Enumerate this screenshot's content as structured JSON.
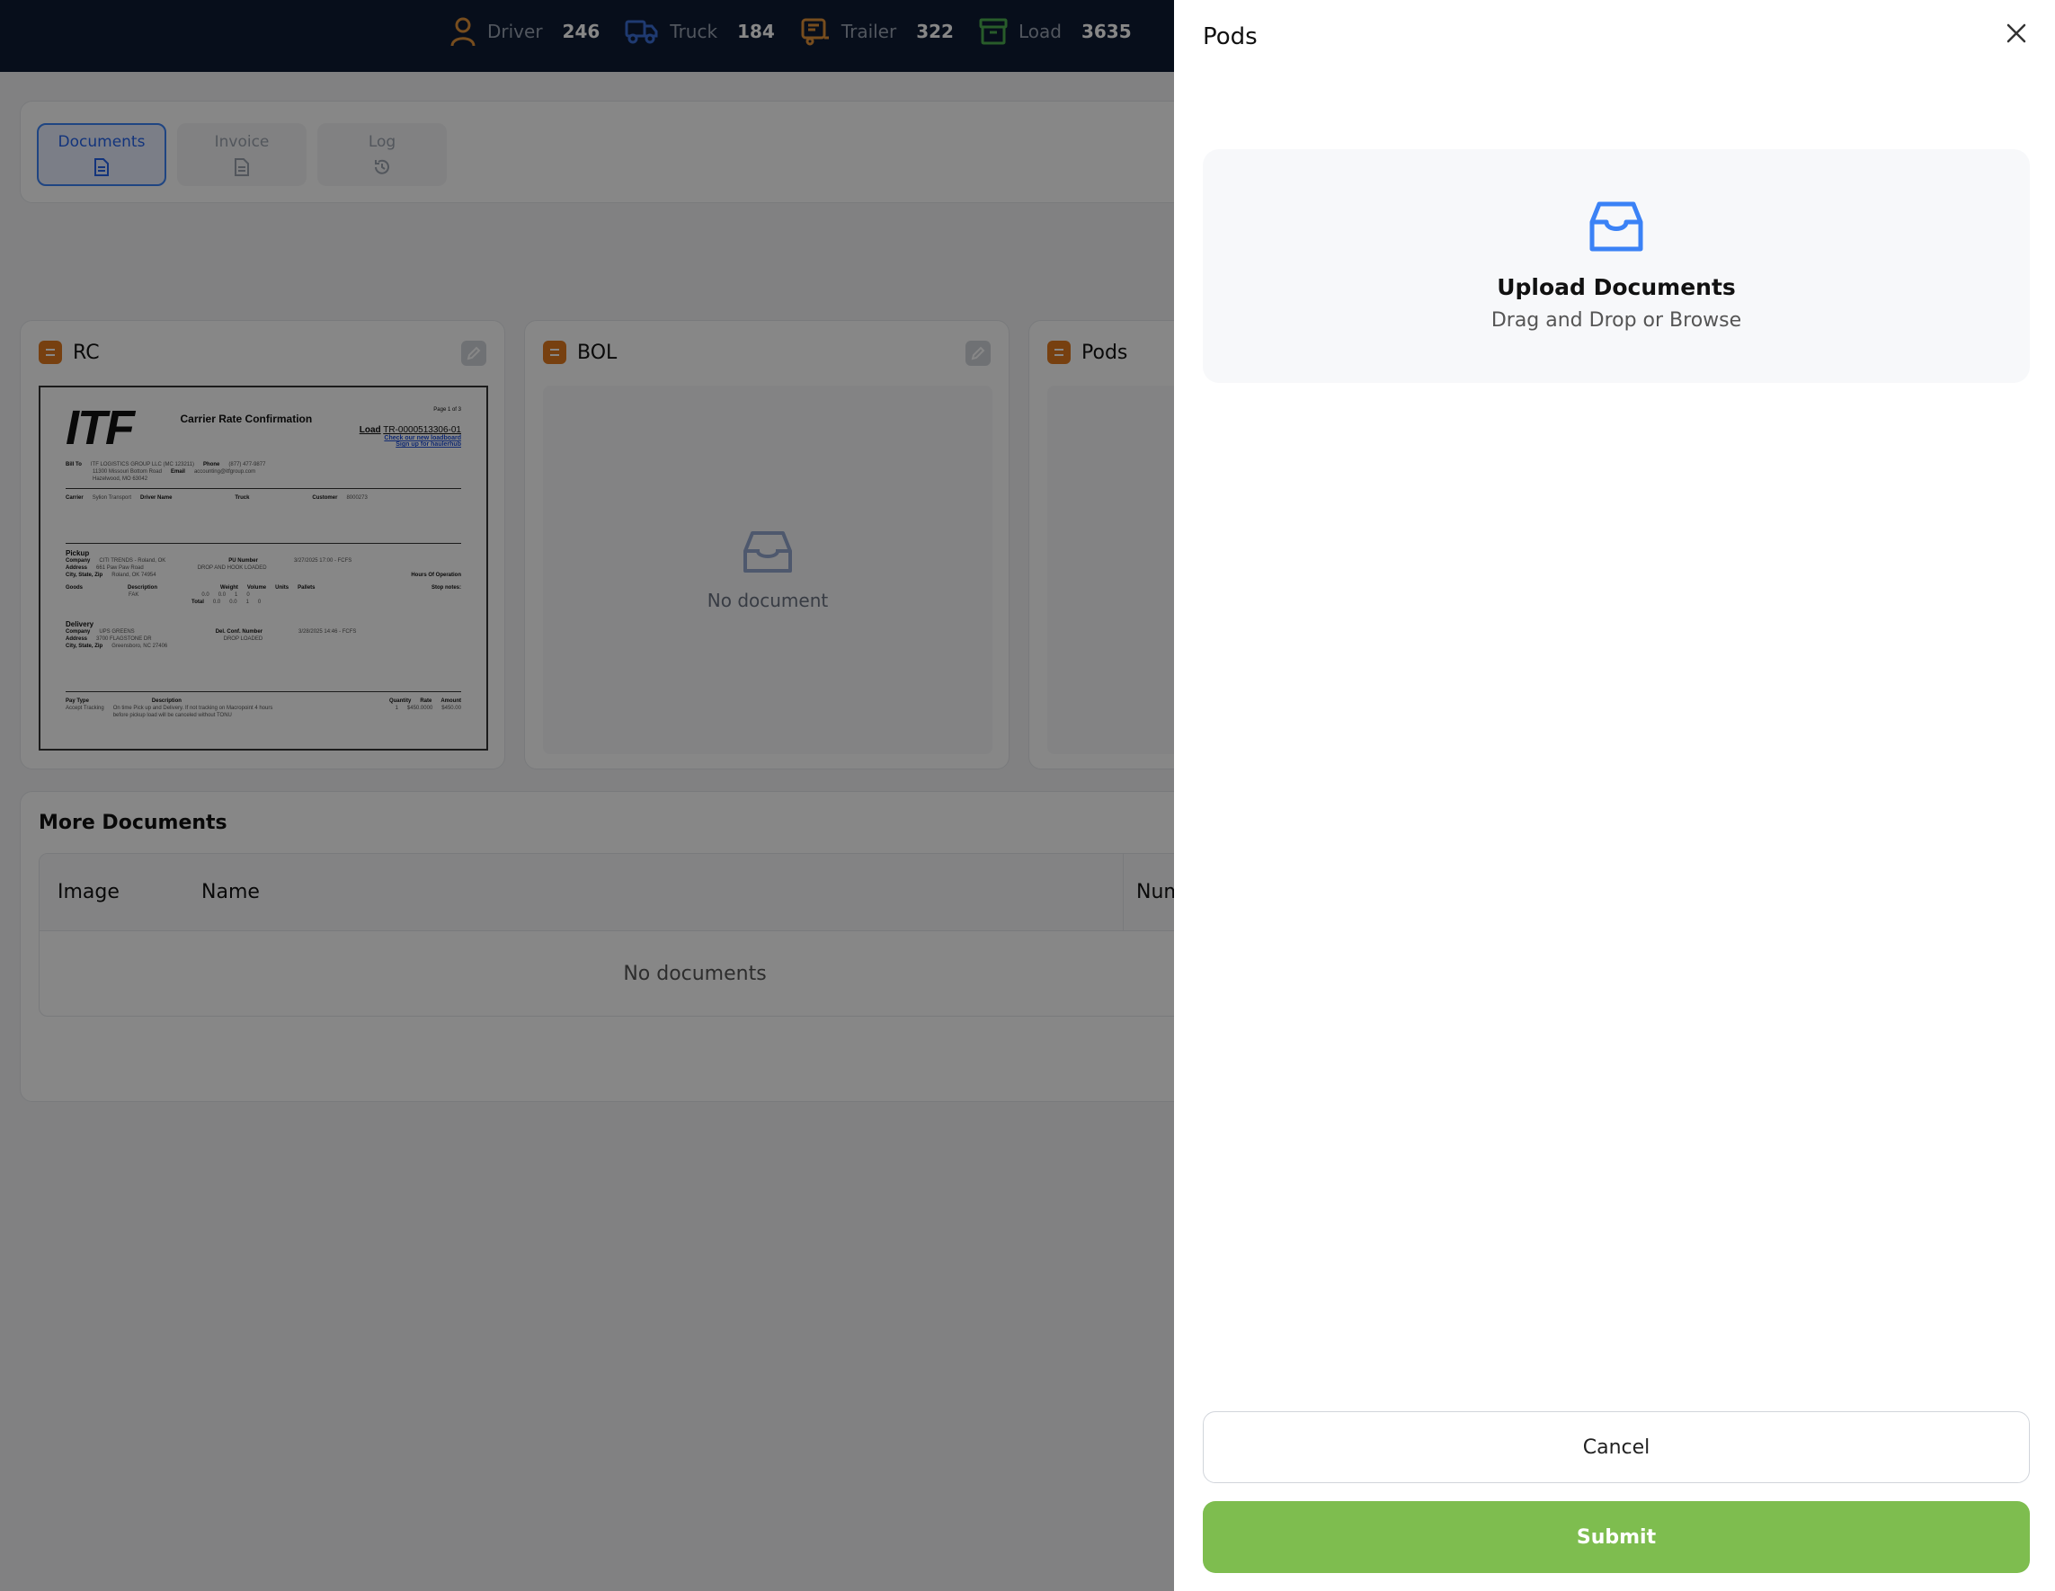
{
  "topbar": {
    "stats": [
      {
        "label": "Driver",
        "count": "246",
        "icon": "person-icon",
        "color": "#e0913a"
      },
      {
        "label": "Truck",
        "count": "184",
        "icon": "truck-icon",
        "color": "#3b6fd6"
      },
      {
        "label": "Trailer",
        "count": "322",
        "icon": "trailer-icon",
        "color": "#e0913a"
      },
      {
        "label": "Load",
        "count": "3635",
        "icon": "box-icon",
        "color": "#4caf50"
      }
    ]
  },
  "tabs": [
    {
      "label": "Documents",
      "active": true
    },
    {
      "label": "Invoice",
      "active": false
    },
    {
      "label": "Log",
      "active": false
    }
  ],
  "doc_cards": [
    {
      "title": "RC"
    },
    {
      "title": "BOL",
      "empty_text": "No document"
    },
    {
      "title": "Pods"
    }
  ],
  "rc_preview": {
    "logo": "ITF",
    "title": "Carrier Rate Confirmation",
    "page": "Page 1 of 3",
    "load_label": "Load",
    "load_number": "TR-0000513306-01",
    "link1": "Check our new loadboard",
    "link2": "Sign up for haulerhub",
    "bill_to_label": "Bill To",
    "bill_to": "ITF LOGISTICS GROUP LLC (MC 123211)",
    "bill_addr1": "11300 Missouri Bottom Road",
    "bill_addr2": "Hazelwood, MO 63042",
    "phone_label": "Phone",
    "phone": "(877) 477-9877",
    "email_label": "Email",
    "email": "accounting@itfgroup.com",
    "carrier_label": "Carrier",
    "carrier": "Sylion Transport",
    "driver_name_label": "Driver Name",
    "truck_label": "Truck",
    "customer_label": "Customer",
    "customer": "8000273",
    "pickup_label": "Pickup",
    "pickup_company_label": "Company",
    "pickup_company": "CITI TRENDS - Roland, OK",
    "pickup_address_label": "Address",
    "pickup_address": "661 Paw Paw Road",
    "pickup_city_label": "City, State, Zip",
    "pickup_city": "Roland, OK 74954",
    "pu_number_label": "PU Number",
    "pickup_note": "DROP AND HOOK LOADED",
    "appointment_label": "Appointment",
    "pickup_appt": "3/27/2025 17:00 - FCFS",
    "hours_label": "Hours Of Operation",
    "stop_notes_label": "Stop notes:",
    "goods_label": "Goods",
    "description_label": "Description",
    "weight_label": "Weight",
    "volume_label": "Volume",
    "units_label": "Units",
    "pallets_label": "Pallets",
    "goods_desc": "FAK",
    "zero": "0.0",
    "one": "1",
    "zero_int": "0",
    "total_label": "Total",
    "delivery_label": "Delivery",
    "delivery_company": "UPS GREENS",
    "delivery_address": "3700 FLAGSTONE DR",
    "delivery_city": "Greensboro, NC 27406",
    "del_conf_label": "Del. Conf. Number",
    "delivery_note": "DROP LOADED",
    "delivery_appt": "3/28/2025 14:46 - FCFS",
    "pay_type_label": "Pay Type",
    "quantity_label": "Quantity",
    "rate_label": "Rate",
    "amount_label": "Amount",
    "pay_type": "Accept Tracking",
    "pay_desc": "On time Pick up and Delivery. If not tracking on Macropoint 4 hours before pickup load will be canceled without TONU",
    "quantity": "1",
    "rate": "$450.0000",
    "amount": "$450.00"
  },
  "more_documents": {
    "title": "More Documents",
    "columns": [
      "Image",
      "Name",
      "Numb"
    ],
    "empty_text": "No documents"
  },
  "drawer": {
    "title": "Pods",
    "upload_title": "Upload Documents",
    "upload_sub": "Drag and Drop or Browse",
    "cancel_label": "Cancel",
    "submit_label": "Submit"
  }
}
